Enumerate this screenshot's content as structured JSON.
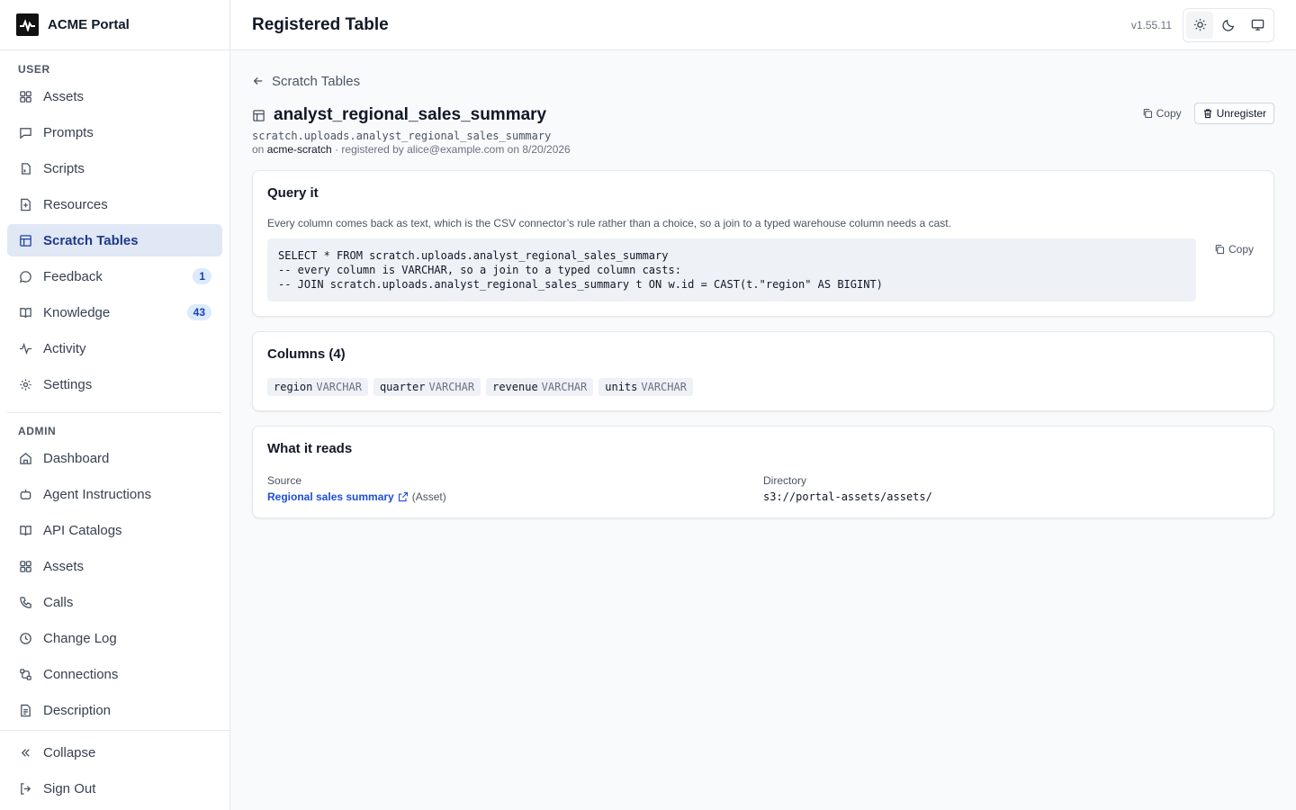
{
  "brand": {
    "name": "ACME Portal"
  },
  "sidebar": {
    "user_label": "USER",
    "user_items": [
      {
        "label": "Assets",
        "icon": "grid-icon"
      },
      {
        "label": "Prompts",
        "icon": "message-icon"
      },
      {
        "label": "Scripts",
        "icon": "terminal-icon"
      },
      {
        "label": "Resources",
        "icon": "file-plus-icon"
      },
      {
        "label": "Scratch Tables",
        "icon": "table-icon",
        "active": true
      },
      {
        "label": "Feedback",
        "icon": "chat-icon",
        "badge": "1"
      },
      {
        "label": "Knowledge",
        "icon": "book-icon",
        "badge": "43"
      },
      {
        "label": "Activity",
        "icon": "activity-icon"
      },
      {
        "label": "Settings",
        "icon": "gear-icon"
      }
    ],
    "admin_label": "ADMIN",
    "admin_items": [
      {
        "label": "Dashboard",
        "icon": "home-icon"
      },
      {
        "label": "Agent Instructions",
        "icon": "bot-icon"
      },
      {
        "label": "API Catalogs",
        "icon": "book-open-icon"
      },
      {
        "label": "Assets",
        "icon": "grid-icon"
      },
      {
        "label": "Calls",
        "icon": "phone-icon"
      },
      {
        "label": "Change Log",
        "icon": "history-icon"
      },
      {
        "label": "Connections",
        "icon": "connection-icon"
      },
      {
        "label": "Description",
        "icon": "document-icon"
      }
    ],
    "collapse": "Collapse",
    "sign_out": "Sign Out"
  },
  "header": {
    "title": "Registered Table",
    "version": "v1.55.11"
  },
  "page": {
    "back_label": "Scratch Tables",
    "table_name": "analyst_regional_sales_summary",
    "fqn": "scratch.uploads.analyst_regional_sales_summary",
    "meta_on": "on",
    "meta_catalog": "acme-scratch",
    "meta_rest": "· registered by alice@example.com on 8/20/2026",
    "copy_label": "Copy",
    "unregister_label": "Unregister"
  },
  "query": {
    "title": "Query it",
    "note": "Every column comes back as text, which is the CSV connector’s rule rather than a choice, so a join to a typed warehouse column needs a cast.",
    "code": "SELECT * FROM scratch.uploads.analyst_regional_sales_summary\n-- every column is VARCHAR, so a join to a typed column casts:\n-- JOIN scratch.uploads.analyst_regional_sales_summary t ON w.id = CAST(t.\"region\" AS BIGINT)",
    "copy_label": "Copy"
  },
  "columns": {
    "title": "Columns (4)",
    "items": [
      {
        "name": "region",
        "type": "VARCHAR"
      },
      {
        "name": "quarter",
        "type": "VARCHAR"
      },
      {
        "name": "revenue",
        "type": "VARCHAR"
      },
      {
        "name": "units",
        "type": "VARCHAR"
      }
    ]
  },
  "reads": {
    "title": "What it reads",
    "source_label": "Source",
    "source_link": "Regional sales summary",
    "source_kind": "(Asset)",
    "directory_label": "Directory",
    "directory_value": "s3://portal-assets/assets/"
  }
}
